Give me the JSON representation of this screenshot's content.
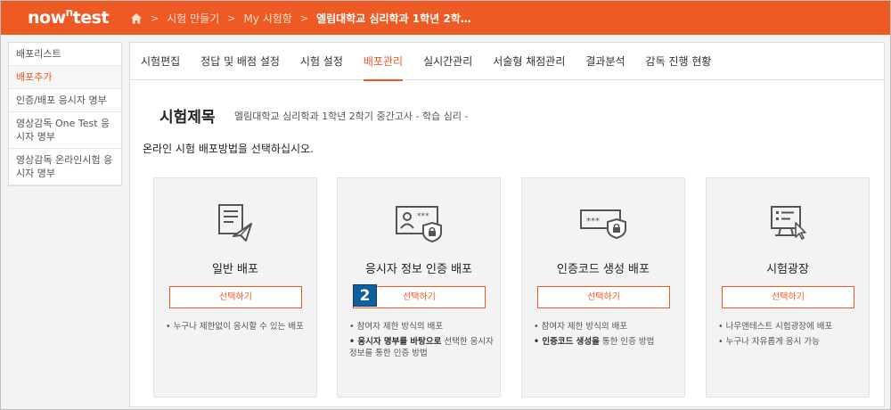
{
  "app": {
    "logo": "now",
    "logo_sup": "n",
    "logo_tail": "test"
  },
  "breadcrumb": [
    "시험 만들기",
    "My 시험함",
    "엘림대학교 심리학과 1학년 2학…"
  ],
  "sidebar": {
    "items": [
      {
        "label": "배포리스트"
      },
      {
        "label": "배포추가"
      },
      {
        "label": "인증/배포 응시자 명부"
      },
      {
        "label": "영상감독 One Test 응시자 명부"
      },
      {
        "label": "영상감독 온라인시험 응시자 명부"
      }
    ]
  },
  "tabs": [
    {
      "label": "시험편집"
    },
    {
      "label": "정답 및 배점 설정"
    },
    {
      "label": "시험 설정"
    },
    {
      "label": "배포관리"
    },
    {
      "label": "실시간관리"
    },
    {
      "label": "서술형 채점관리"
    },
    {
      "label": "결과분석"
    },
    {
      "label": "감독 진행 현황"
    }
  ],
  "exam": {
    "title": "시험제목",
    "subtitle": "엘림대학교 심리학과 1학년 2학기 중간고사 - 학습 심리 -",
    "instruction": "온라인 시험 배포방법을 선택하십시오."
  },
  "cards": [
    {
      "name": "일반 배포",
      "button": "선택하기",
      "bullets": [
        {
          "text": "• 누구나 제한없이 응시할 수 있는 배포"
        }
      ]
    },
    {
      "name": "응시자 정보 인증 배포",
      "button": "선택하기",
      "bullets": [
        {
          "text": "• 참여자 제한 방식의 배포"
        },
        {
          "bold": "• 응시자 명부를 바탕으로",
          "text": " 선택한 응시자 정보를 통한 인증 방법"
        }
      ]
    },
    {
      "name": "인증코드 생성 배포",
      "button": "선택하기",
      "bullets": [
        {
          "text": "• 참여자 제한 방식의 배포"
        },
        {
          "bold": "• 인증코드 생성을",
          "text": " 통한 인증 방법"
        }
      ]
    },
    {
      "name": "시험광장",
      "button": "선택하기",
      "bullets": [
        {
          "text": "• 나우앤테스트 시험광장에 배포"
        },
        {
          "text": "• 누구나 자유롭게 응시 가능"
        }
      ]
    }
  ],
  "annotation": {
    "step": "2"
  },
  "colors": {
    "accent": "#ee5a24",
    "badge": "#0f5f9f",
    "card_bg": "#f3f3f3"
  }
}
